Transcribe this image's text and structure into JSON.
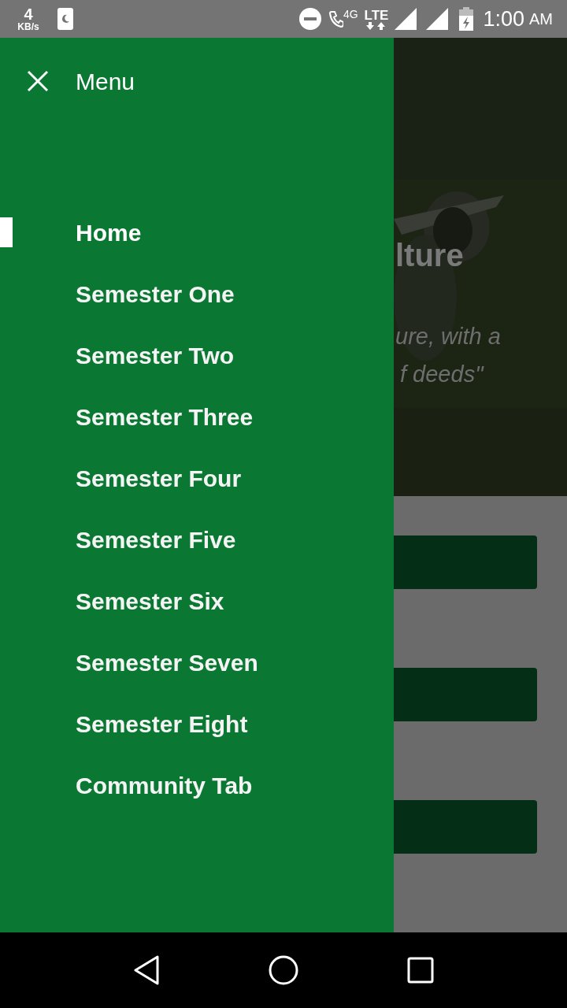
{
  "status_bar": {
    "speed_value": "4",
    "speed_unit": "KB/s",
    "network_label": "4G",
    "lte_label": "LTE",
    "time": "1:00",
    "meridiem": "AM"
  },
  "drawer": {
    "title": "Menu",
    "items": [
      {
        "label": "Home",
        "selected": true
      },
      {
        "label": "Semester One",
        "selected": false
      },
      {
        "label": "Semester Two",
        "selected": false
      },
      {
        "label": "Semester Three",
        "selected": false
      },
      {
        "label": "Semester Four",
        "selected": false
      },
      {
        "label": "Semester Five",
        "selected": false
      },
      {
        "label": "Semester Six",
        "selected": false
      },
      {
        "label": "Semester Seven",
        "selected": false
      },
      {
        "label": "Semester Eight",
        "selected": false
      },
      {
        "label": "Community Tab",
        "selected": false
      }
    ]
  },
  "background": {
    "hero": {
      "kind": "picture",
      "heading": "lture",
      "quote_lines": [
        "ure, with a",
        "f deeds\""
      ]
    },
    "buttons": [
      {
        "kind": "filled"
      },
      {
        "kind": "filled"
      },
      {
        "kind": "filled"
      }
    ]
  }
}
